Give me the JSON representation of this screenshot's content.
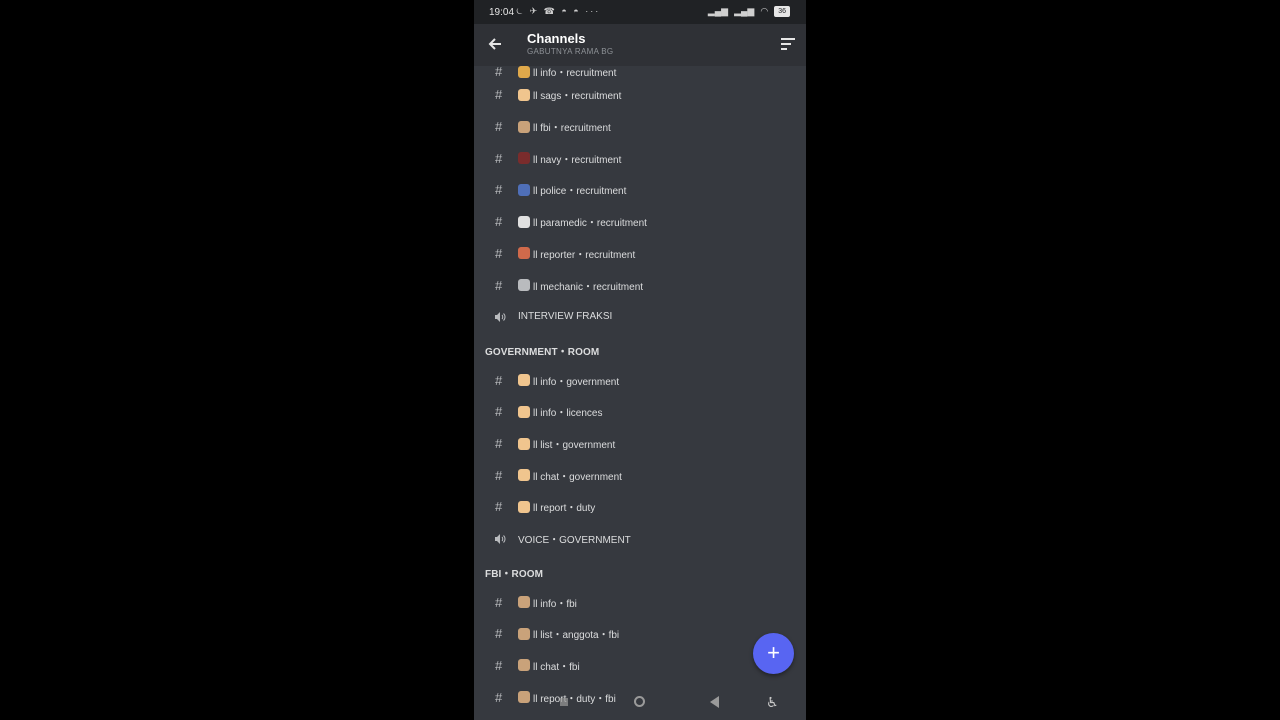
{
  "status": {
    "time": "19:04",
    "notif_icons": "⏾ ✈ ☎ ◓ ◓ ···",
    "battery": "36"
  },
  "header": {
    "title": "Channels",
    "subtitle": "GABUTNYA RAMA BG"
  },
  "top_partial": "ll info・recruitment",
  "rows": [
    {
      "type": "text",
      "emoji_color": "#f0c58e",
      "label": "ll sags・recruitment"
    },
    {
      "type": "text",
      "emoji_color": "#c9a27a",
      "label": "ll fbi・recruitment"
    },
    {
      "type": "text",
      "emoji_color": "#7a2c2c",
      "label": "ll navy・recruitment"
    },
    {
      "type": "text",
      "emoji_color": "#4f6fb8",
      "label": "ll police・recruitment"
    },
    {
      "type": "text",
      "emoji_color": "#e0e0e0",
      "label": "ll paramedic・recruitment"
    },
    {
      "type": "text",
      "emoji_color": "#d06a4b",
      "label": "ll reporter・recruitment"
    },
    {
      "type": "text",
      "emoji_color": "#b9bbbe",
      "label": "ll mechanic・recruitment"
    },
    {
      "type": "voice",
      "label": "INTERVIEW FRAKSI"
    }
  ],
  "cat_gov": "GOVERNMENT・ROOM",
  "gov_rows": [
    {
      "type": "text",
      "emoji_color": "#f0c58e",
      "label": "ll info・government"
    },
    {
      "type": "text",
      "emoji_color": "#f0c58e",
      "label": "ll info・licences"
    },
    {
      "type": "text",
      "emoji_color": "#f0c58e",
      "label": "ll list・government"
    },
    {
      "type": "text",
      "emoji_color": "#f0c58e",
      "label": "ll chat・government"
    },
    {
      "type": "text",
      "emoji_color": "#f0c58e",
      "label": "ll report・duty"
    },
    {
      "type": "voice",
      "label": "VOICE・GOVERNMENT"
    }
  ],
  "cat_fbi": "FBI・ROOM",
  "fbi_rows": [
    {
      "type": "text",
      "emoji_color": "#c9a27a",
      "label": "ll info・fbi"
    },
    {
      "type": "text",
      "emoji_color": "#c9a27a",
      "label": "ll list・anggota・fbi"
    },
    {
      "type": "text",
      "emoji_color": "#c9a27a",
      "label": "ll chat・fbi"
    },
    {
      "type": "text",
      "emoji_color": "#c9a27a",
      "label": "ll report・duty・fbi"
    }
  ],
  "fab_label": "+",
  "icons": {
    "back": "arrow-left-icon",
    "sort": "sort-icon",
    "hash": "hash-icon",
    "voice": "speaker-icon",
    "fab": "plus-icon"
  }
}
